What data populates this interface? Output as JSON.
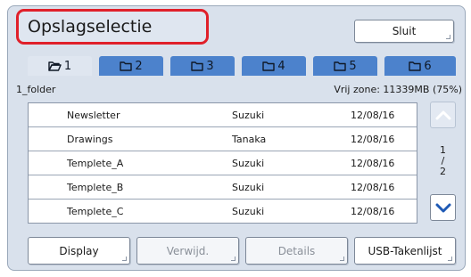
{
  "header": {
    "title": "Opslagselectie",
    "close_label": "Sluit"
  },
  "tabs": [
    {
      "label": "1",
      "active": true
    },
    {
      "label": "2",
      "active": false
    },
    {
      "label": "3",
      "active": false
    },
    {
      "label": "4",
      "active": false
    },
    {
      "label": "5",
      "active": false
    },
    {
      "label": "6",
      "active": false
    }
  ],
  "folder": {
    "name": "1_folder",
    "free_space": "Vrij zone: 11339MB (75%)"
  },
  "files": [
    {
      "name": "Newsletter",
      "owner": "Suzuki",
      "date": "12/08/16"
    },
    {
      "name": "Drawings",
      "owner": "Tanaka",
      "date": "12/08/16"
    },
    {
      "name": "Templete_A",
      "owner": "Suzuki",
      "date": "12/08/16"
    },
    {
      "name": "Templete_B",
      "owner": "Suzuki",
      "date": "12/08/16"
    },
    {
      "name": "Templete_C",
      "owner": "Suzuki",
      "date": "12/08/16"
    }
  ],
  "pagination": {
    "current": "1",
    "separator": "/",
    "total": "2"
  },
  "actions": {
    "display_label": "Display",
    "delete_label": "Verwijd.",
    "details_label": "Details",
    "usb_label": "USB-Takenlijst"
  },
  "colors": {
    "panel_bg": "#d9e1ec",
    "tab_blue": "#4c82cc",
    "highlight_red": "#e0202a",
    "arrow_blue": "#1f5ab5"
  }
}
